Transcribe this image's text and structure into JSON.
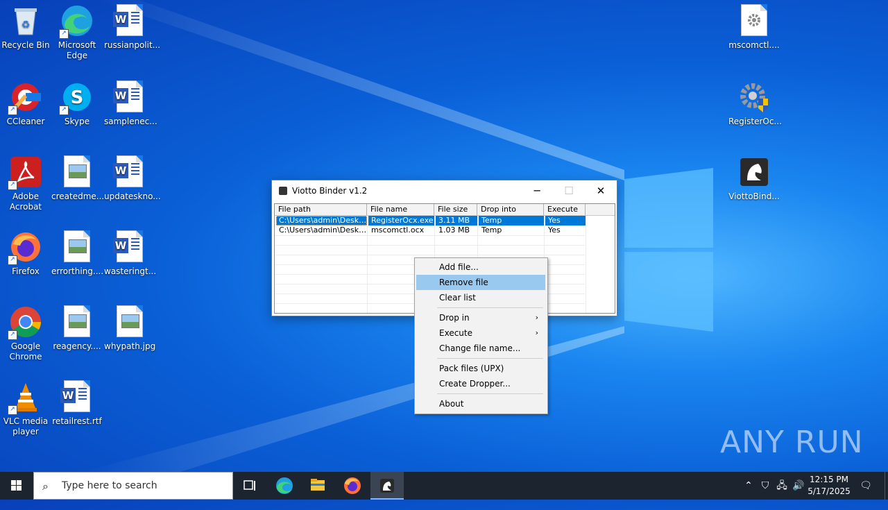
{
  "desktop": {
    "icons": [
      {
        "id": "recycle-bin",
        "label": "Recycle Bin",
        "icon": "recycle-bin-icon"
      },
      {
        "id": "edge",
        "label": "Microsoft Edge",
        "icon": "edge-icon"
      },
      {
        "id": "russianpolit",
        "label": "russianpolit...",
        "icon": "word-doc-icon"
      },
      {
        "id": "ccleaner",
        "label": "CCleaner",
        "icon": "ccleaner-icon"
      },
      {
        "id": "skype",
        "label": "Skype",
        "icon": "skype-icon"
      },
      {
        "id": "samplenec",
        "label": "samplenec...",
        "icon": "word-doc-icon"
      },
      {
        "id": "acrobat",
        "label": "Adobe Acrobat",
        "icon": "acrobat-icon"
      },
      {
        "id": "createdme",
        "label": "createdme...",
        "icon": "image-file-icon"
      },
      {
        "id": "updateskno",
        "label": "updateskno...",
        "icon": "word-doc-icon"
      },
      {
        "id": "firefox",
        "label": "Firefox",
        "icon": "firefox-icon"
      },
      {
        "id": "errorthing",
        "label": "errorthing....",
        "icon": "image-file-icon"
      },
      {
        "id": "wasteringt",
        "label": "wasteringt...",
        "icon": "word-doc-icon"
      },
      {
        "id": "chrome",
        "label": "Google Chrome",
        "icon": "chrome-icon"
      },
      {
        "id": "reagency",
        "label": "reagency....",
        "icon": "image-file-icon"
      },
      {
        "id": "whypath",
        "label": "whypath.jpg",
        "icon": "image-file-icon"
      },
      {
        "id": "vlc",
        "label": "VLC media player",
        "icon": "vlc-icon"
      },
      {
        "id": "retailrest",
        "label": "retailrest.rtf",
        "icon": "word-doc-icon"
      },
      {
        "id": "mscomctl",
        "label": "mscomctl....",
        "icon": "settings-file-icon"
      },
      {
        "id": "registerocx",
        "label": "RegisterOc...",
        "icon": "registerocx-icon"
      },
      {
        "id": "viottobind",
        "label": "ViottoBind...",
        "icon": "viotto-icon"
      }
    ]
  },
  "window": {
    "title": "Viotto Binder v1.2",
    "minimize": "─",
    "maximize": "☐",
    "close": "✕",
    "columns": [
      "File path",
      "File name",
      "File size",
      "Drop into",
      "Execute"
    ],
    "rows": [
      [
        "C:\\Users\\admin\\Deskto...",
        "RegisterOcx.exe",
        "3.11 MB",
        "Temp",
        "Yes"
      ],
      [
        "C:\\Users\\admin\\Deskto...",
        "mscomctl.ocx",
        "1.03 MB",
        "Temp",
        "Yes"
      ]
    ]
  },
  "context_menu": {
    "items": [
      {
        "label": "Add file..."
      },
      {
        "label": "Remove file",
        "highlighted": true
      },
      {
        "label": "Clear list"
      },
      {
        "label": "Drop in",
        "submenu": true
      },
      {
        "label": "Execute",
        "submenu": true
      },
      {
        "label": "Change file name..."
      },
      {
        "label": "Pack files (UPX)"
      },
      {
        "label": "Create Dropper..."
      },
      {
        "label": "About"
      }
    ],
    "arrow": "›"
  },
  "watermark": "ANY  RUN",
  "taskbar": {
    "search_placeholder": "Type here to search",
    "time": "12:15 PM",
    "date": "5/17/2025"
  },
  "colors": {
    "selection": "#0078d7",
    "menu_highlight": "#99c9ef",
    "taskbar": "#1c2430"
  }
}
